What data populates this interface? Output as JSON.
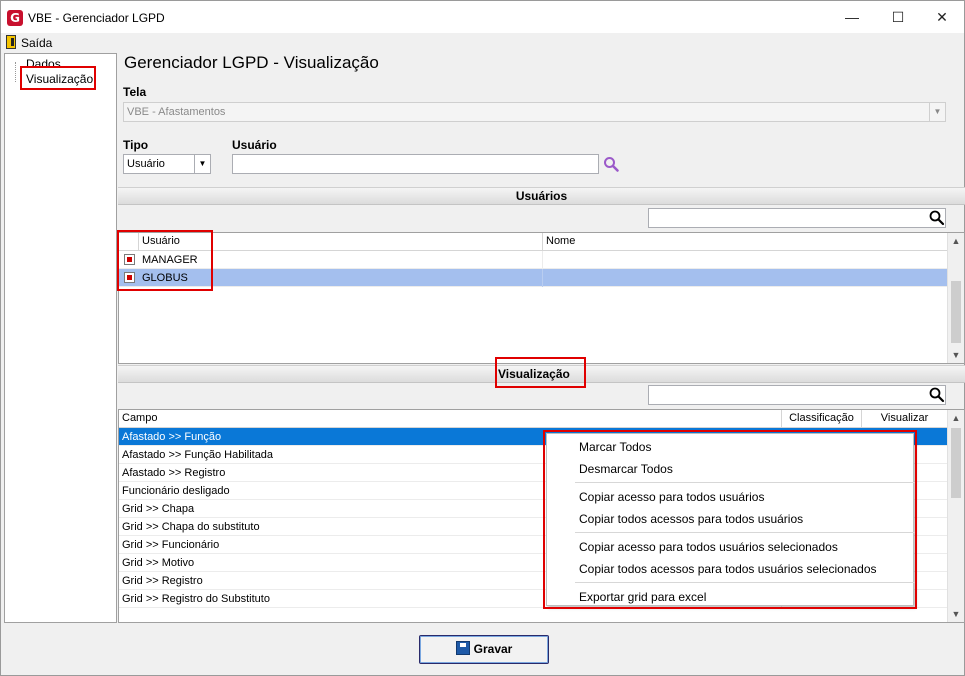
{
  "window": {
    "title": "VBE - Gerenciador LGPD",
    "app_icon_letter": "G",
    "minimize": "—",
    "maximize": "☐",
    "close": "✕"
  },
  "menu": {
    "exit_label": "Saída"
  },
  "tree": {
    "items": [
      {
        "label": "Dados"
      },
      {
        "label": "Visualização"
      }
    ]
  },
  "page": {
    "title": "Gerenciador LGPD - Visualização"
  },
  "form": {
    "tela_label": "Tela",
    "tela_value": "VBE - Afastamentos",
    "tipo_label": "Tipo",
    "tipo_value": "Usuário",
    "usuario_label": "Usuário",
    "usuario_value": ""
  },
  "users_section": {
    "title": "Usuários",
    "search_value": "",
    "columns": [
      "Usuário",
      "Nome"
    ],
    "rows": [
      {
        "user": "MANAGER",
        "name": "",
        "checked": true
      },
      {
        "user": "GLOBUS",
        "name": "",
        "checked": true
      }
    ]
  },
  "view_section": {
    "title": "Visualização",
    "search_value": "",
    "columns": [
      "Campo",
      "Classificação",
      "Visualizar"
    ],
    "rows": [
      {
        "campo": "Afastado >> Função"
      },
      {
        "campo": "Afastado >> Função Habilitada"
      },
      {
        "campo": "Afastado >> Registro"
      },
      {
        "campo": "Funcionário desligado"
      },
      {
        "campo": "Grid >> Chapa"
      },
      {
        "campo": "Grid >> Chapa do substituto"
      },
      {
        "campo": "Grid >> Funcionário"
      },
      {
        "campo": "Grid >> Motivo"
      },
      {
        "campo": "Grid >> Registro"
      },
      {
        "campo": "Grid >> Registro do Substituto"
      }
    ]
  },
  "context_menu": {
    "items": [
      "Marcar Todos",
      "Desmarcar Todos",
      "Copiar acesso para todos usuários",
      "Copiar todos acessos para todos usuários",
      "Copiar acesso para todos usuários selecionados",
      "Copiar todos acessos para todos usuários selecionados",
      "Exportar grid para excel"
    ]
  },
  "footer": {
    "save_label": "Gravar"
  },
  "colors": {
    "highlight_red": "#e00000",
    "selected_row_blue": "#0a78d7",
    "globus_row_blue": "#a4bfee",
    "search_icon_purple": "#9b59c9"
  }
}
